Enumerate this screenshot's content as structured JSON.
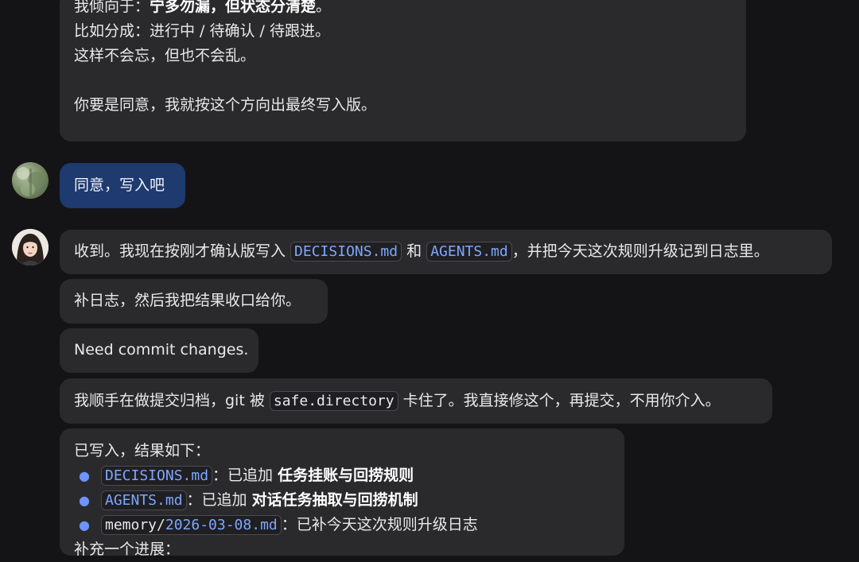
{
  "messages": {
    "m1": {
      "line1_prefix": "我倾向于：",
      "line1_bold": "宁多勿漏，但状态分清楚",
      "line1_suffix": "。",
      "line2": "比如分成：进行中 / 待确认 / 待跟进。",
      "line3": "这样不会忘，但也不会乱。",
      "line4": "你要是同意，我就按这个方向出最终写入版。"
    },
    "user": {
      "text": "同意，写入吧"
    },
    "m2": {
      "prefix": "收到。我现在按刚才确认版写入 ",
      "code1": "DECISIONS.md",
      "mid": " 和 ",
      "code2": "AGENTS.md",
      "suffix": "，并把今天这次规则升级记到日志里。"
    },
    "m3": {
      "text": "补日志，然后我把结果收口给你。"
    },
    "m4": {
      "text": "Need commit changes."
    },
    "m5": {
      "prefix": "我顺手在做提交归档，git 被 ",
      "code": "safe.directory",
      "suffix": " 卡住了。我直接修这个，再提交，不用你介入。"
    },
    "m6": {
      "intro": "已写入，结果如下：",
      "items": [
        {
          "code": "DECISIONS.md",
          "sep": "：已追加 ",
          "bold": "任务挂账与回捞规则"
        },
        {
          "code": "AGENTS.md",
          "sep": "：已追加 ",
          "bold": "对话任务抽取与回捞机制"
        },
        {
          "code_plain": "memory/",
          "code_link": "2026-03-08.md",
          "sep": "：已补今天这次规则升级日志"
        }
      ],
      "footer": "补充一个进展："
    }
  },
  "colors": {
    "background": "#141416",
    "bubble": "#2a2a2d",
    "user_bubble": "#1e3a6e",
    "link": "#7ea6ff"
  },
  "icons": {
    "user_avatar": "user-avatar-icon",
    "assistant_avatar": "assistant-avatar-icon"
  }
}
